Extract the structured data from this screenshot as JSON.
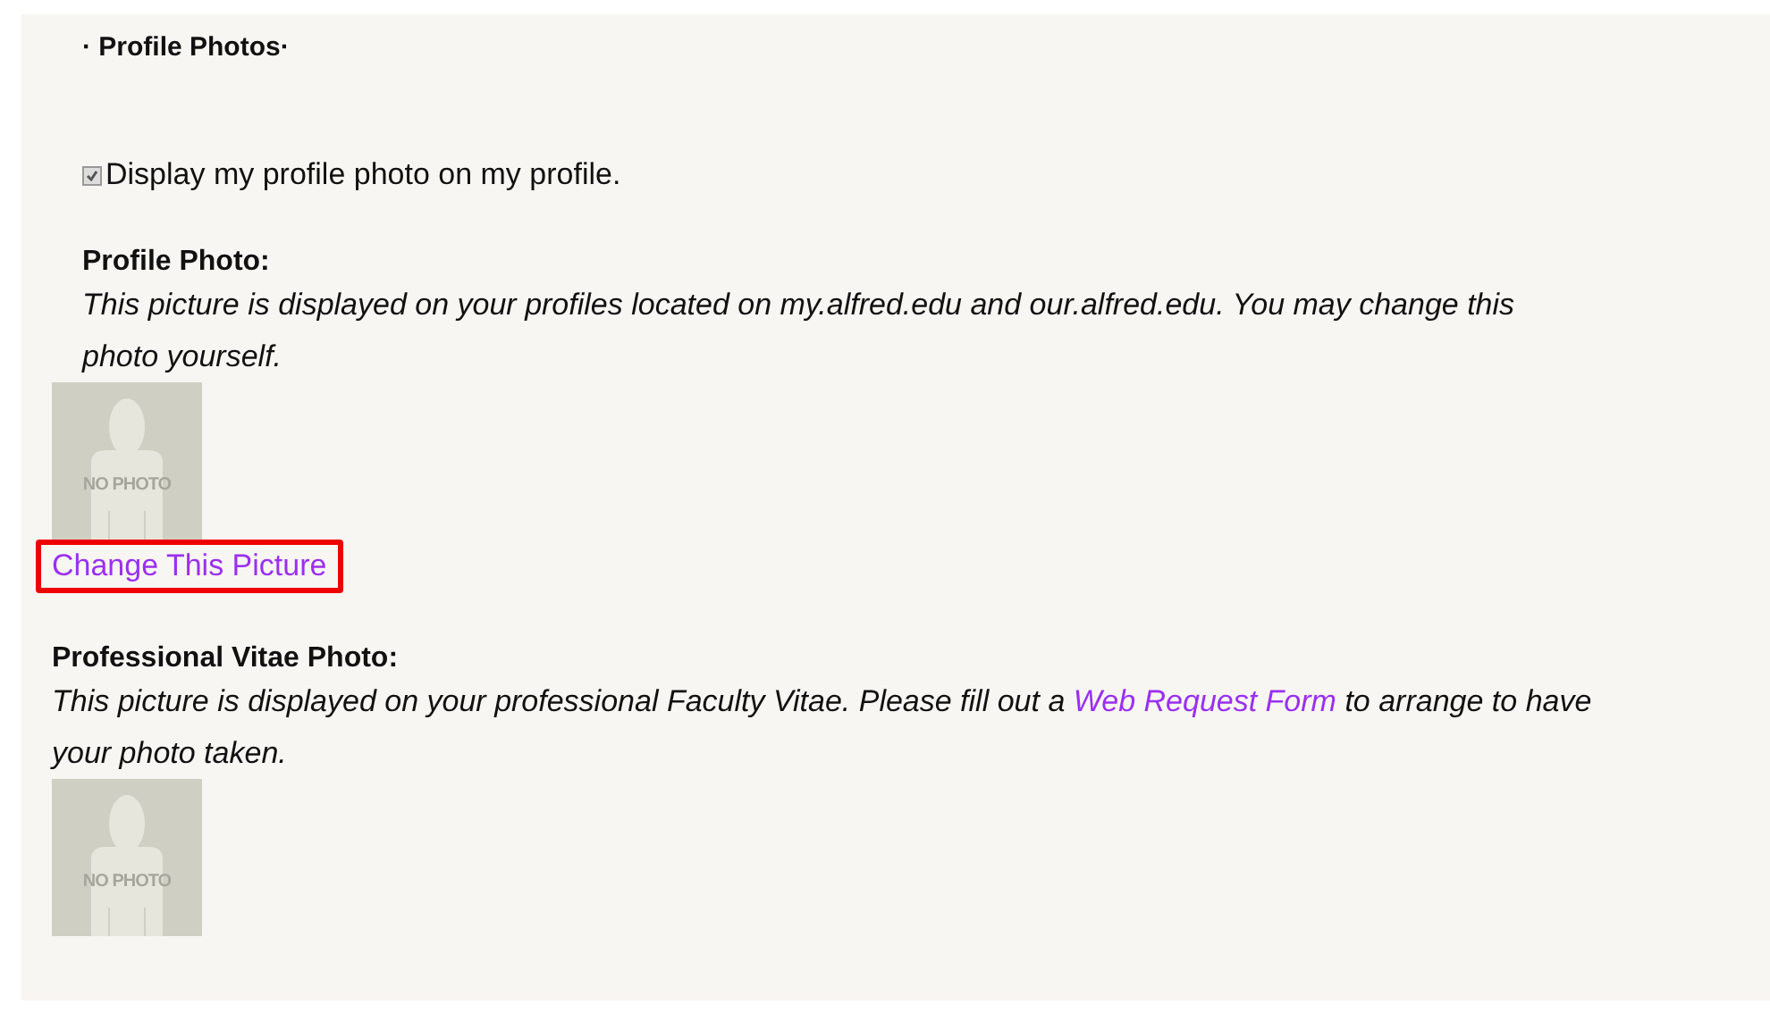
{
  "heading": "· Profile Photos·",
  "display_option": {
    "label": "Display my profile photo on my profile.",
    "checked": true
  },
  "profile_photo": {
    "title": "Profile Photo:",
    "description": "This picture is displayed on your profiles located on my.alfred.edu and our.alfred.edu. You may change this photo yourself.",
    "placeholder_text": "NO PHOTO",
    "link": {
      "label": "Change This Picture",
      "highlighted": true
    }
  },
  "vitae_photo": {
    "title": "Professional Vitae Photo:",
    "description_before": "This picture is displayed on your professional Faculty Vitae. Please fill out a",
    "link": "Web Request Form",
    "description_after": "to arrange to have your photo taken.",
    "placeholder_text": "NO PHOTO"
  }
}
